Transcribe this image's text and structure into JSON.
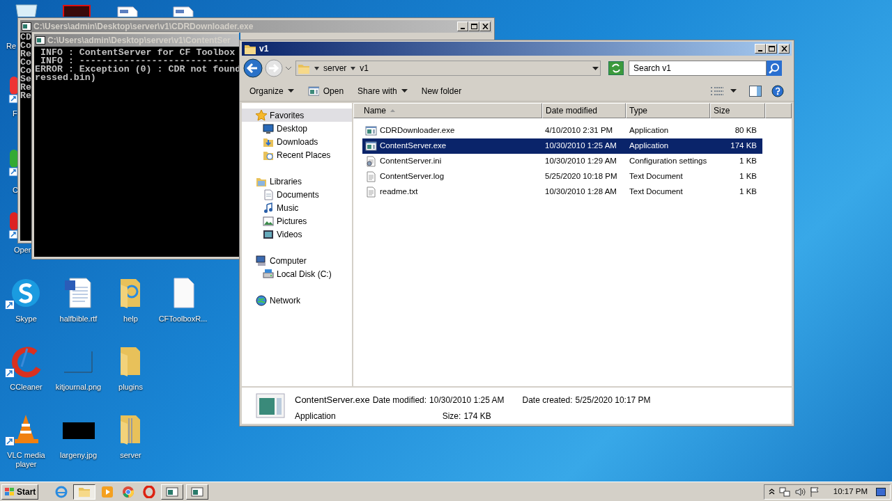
{
  "desktop": {
    "top_icons": [
      {
        "kind": "bin"
      },
      {
        "kind": "redbox"
      },
      {
        "kind": "doc"
      },
      {
        "kind": "doc"
      }
    ],
    "left_labels": [
      "Re",
      "F",
      "C",
      "Oper"
    ],
    "icons": [
      {
        "label": "Skype",
        "kind": "skype",
        "shortcut": true
      },
      {
        "label": "halfbible.rtf",
        "kind": "word",
        "shortcut": false
      },
      {
        "label": "help",
        "kind": "folder-ie",
        "shortcut": false
      },
      {
        "label": "CFToolboxR...",
        "kind": "blank",
        "shortcut": false
      },
      {
        "label": "CCleaner",
        "kind": "ccleaner",
        "shortcut": true
      },
      {
        "label": "kitjournal.png",
        "kind": "thin",
        "shortcut": false
      },
      {
        "label": "plugins",
        "kind": "folder",
        "shortcut": false
      },
      {
        "label": "VLC media player",
        "kind": "vlc",
        "shortcut": true
      },
      {
        "label": "largeny.jpg",
        "kind": "dark",
        "shortcut": false
      },
      {
        "label": "server",
        "kind": "folder-zip",
        "shortcut": false
      }
    ]
  },
  "consoles": [
    {
      "title": "C:\\Users\\admin\\Desktop\\server\\v1\\CDRDownloader.exe",
      "lines": [
        "CD",
        "Co",
        "Re",
        "Co",
        "Co",
        "Se",
        "Re",
        "Re"
      ]
    },
    {
      "title": "C:\\Users\\admin\\Desktop\\server\\v1\\ContentSer",
      "lines": [
        " INFO : ContentServer for CF Toolbox",
        " INFO : ----------------------------",
        "ERROR : Exception (0) : CDR not found",
        "ressed.bin)"
      ]
    }
  ],
  "explorer": {
    "title": "v1",
    "breadcrumb": [
      "server",
      "v1"
    ],
    "search": {
      "placeholder": "Search v1"
    },
    "toolbar": [
      {
        "label": "Organize",
        "kind": "menu"
      },
      {
        "label": "Open",
        "kind": "icon"
      },
      {
        "label": "Share with",
        "kind": "menu"
      },
      {
        "label": "New folder",
        "kind": "plain"
      }
    ],
    "nav": [
      {
        "label": "Favorites",
        "kind": "star",
        "selected": true,
        "children": [
          {
            "label": "Desktop",
            "kind": "desktop",
            "selected": false
          },
          {
            "label": "Downloads",
            "kind": "downloads",
            "selected": false
          },
          {
            "label": "Recent Places",
            "kind": "recent",
            "selected": false
          }
        ]
      },
      {
        "label": "Libraries",
        "kind": "library",
        "selected": false,
        "children": [
          {
            "label": "Documents",
            "kind": "documents",
            "selected": false
          },
          {
            "label": "Music",
            "kind": "music",
            "selected": false
          },
          {
            "label": "Pictures",
            "kind": "pictures",
            "selected": false
          },
          {
            "label": "Videos",
            "kind": "videos",
            "selected": false
          }
        ]
      },
      {
        "label": "Computer",
        "kind": "computer",
        "selected": false,
        "children": [
          {
            "label": "Local Disk (C:)",
            "kind": "disk",
            "selected": false
          }
        ]
      },
      {
        "label": "Network",
        "kind": "network",
        "selected": false
      }
    ],
    "columns": [
      {
        "label": "Name",
        "sorted": true
      },
      {
        "label": "Date modified",
        "sorted": false
      },
      {
        "label": "Type",
        "sorted": false
      },
      {
        "label": "Size",
        "sorted": false
      }
    ],
    "rows": [
      {
        "name": "CDRDownloader.exe",
        "kind": "exe",
        "date": "4/10/2010 2:31 PM",
        "type": "Application",
        "size": "80 KB",
        "selected": false
      },
      {
        "name": "ContentServer.exe",
        "kind": "exe",
        "date": "10/30/2010 1:25 AM",
        "type": "Application",
        "size": "174 KB",
        "selected": true
      },
      {
        "name": "ContentServer.ini",
        "kind": "ini",
        "date": "10/30/2010 1:29 AM",
        "type": "Configuration settings",
        "size": "1 KB",
        "selected": false
      },
      {
        "name": "ContentServer.log",
        "kind": "txt",
        "date": "5/25/2020 10:18 PM",
        "type": "Text Document",
        "size": "1 KB",
        "selected": false
      },
      {
        "name": "readme.txt",
        "kind": "txt",
        "date": "10/30/2010 1:28 AM",
        "type": "Text Document",
        "size": "1 KB",
        "selected": false
      }
    ],
    "details": {
      "name": "ContentServer.exe",
      "type": "Application",
      "modified_label": "Date modified:",
      "modified": "10/30/2010 1:25 AM",
      "created_label": "Date created:",
      "created": "5/25/2020 10:17 PM",
      "size_label": "Size:",
      "size": "174 KB"
    }
  },
  "taskbar": {
    "start": "Start",
    "apps": [
      {
        "kind": "ie",
        "selected": false
      },
      {
        "kind": "explorer",
        "selected": true
      },
      {
        "kind": "media",
        "selected": false
      },
      {
        "kind": "chrome",
        "selected": false
      },
      {
        "kind": "opera",
        "selected": false
      },
      {
        "kind": "console",
        "selected": false
      },
      {
        "kind": "console",
        "selected": false
      }
    ],
    "clock": "10:17 PM"
  }
}
